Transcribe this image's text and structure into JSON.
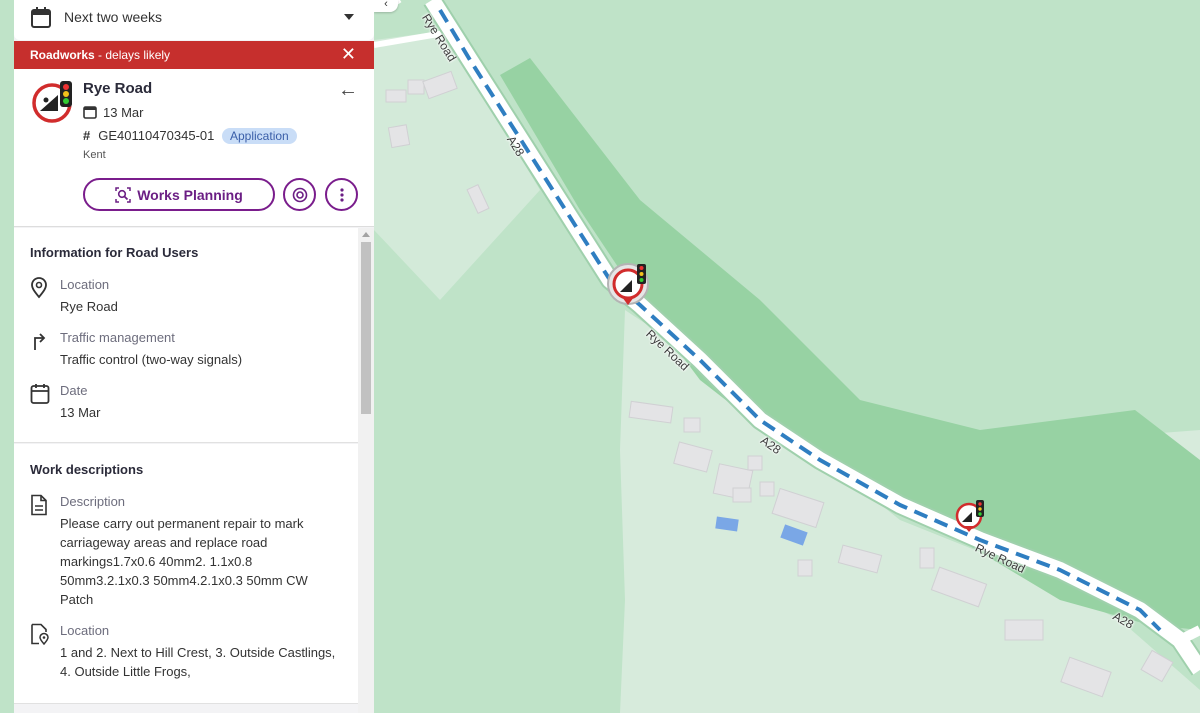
{
  "filter": {
    "date_range": "Next two weeks"
  },
  "alert": {
    "type": "Roadworks",
    "message": "- delays likely"
  },
  "works": {
    "title": "Rye Road",
    "date": "13 Mar",
    "reference": "GE40110470345-01",
    "status": "Application",
    "authority": "Kent"
  },
  "actions": {
    "works_planning_label": "Works Planning"
  },
  "road_users": {
    "heading": "Information for Road Users",
    "location_label": "Location",
    "location_value": "Rye Road",
    "traffic_label": "Traffic management",
    "traffic_value": "Traffic control (two-way signals)",
    "date_label": "Date",
    "date_value": "13 Mar"
  },
  "work_descriptions": {
    "heading": "Work descriptions",
    "description_label": "Description",
    "description_value": "Please carry out permanent repair to mark carriageway areas and replace road markings1.7x0.6 40mm2. 1.1x0.8 50mm3.2.1x0.3 50mm4.2.1x0.3 50mm CW Patch",
    "location_label": "Location",
    "location_value": "1 and 2. Next to Hill Crest, 3. Outside Castlings, 4. Outside Little Frogs,"
  },
  "map": {
    "road_labels": [
      "Rye Road",
      "A28",
      "Rye Road",
      "A28",
      "Rye Road",
      "A28"
    ],
    "collapse_glyph": "‹",
    "colors": {
      "land": "#bfe3c8",
      "wood": "#97d2a3",
      "plot": "#dcebe0",
      "road": "#ffffff",
      "route": "#2f7ec1",
      "accent": "#7a1d8c",
      "alert": "#c62f2d"
    }
  },
  "icons": [
    "calendar-icon",
    "caret-down-icon",
    "close-icon",
    "roadworks-icon",
    "arrow-left-icon",
    "hash-icon",
    "search-doc-icon",
    "target-icon",
    "more-vertical-icon",
    "location-pin-icon",
    "turn-arrow-icon",
    "document-icon",
    "document-pin-icon"
  ]
}
